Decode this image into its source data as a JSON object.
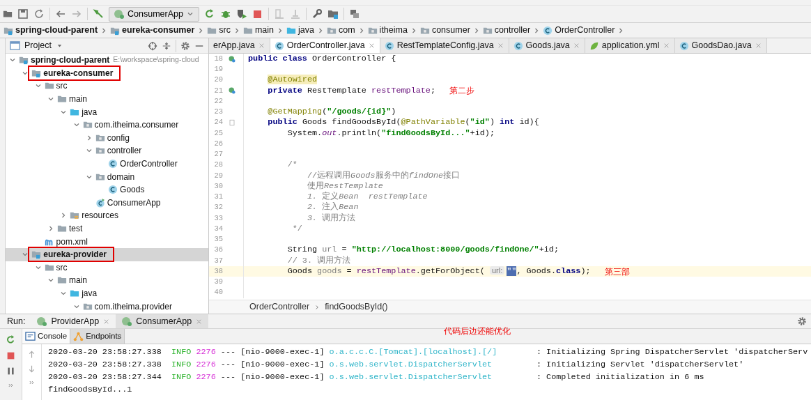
{
  "toolbar": {
    "run_config": "ConsumerApp"
  },
  "breadcrumbs": [
    {
      "label": "spring-cloud-parent",
      "kind": "module"
    },
    {
      "label": "eureka-consumer",
      "kind": "module"
    },
    {
      "label": "src",
      "kind": "folder"
    },
    {
      "label": "main",
      "kind": "folder"
    },
    {
      "label": "java",
      "kind": "source"
    },
    {
      "label": "com",
      "kind": "package"
    },
    {
      "label": "itheima",
      "kind": "package"
    },
    {
      "label": "consumer",
      "kind": "package"
    },
    {
      "label": "controller",
      "kind": "package"
    },
    {
      "label": "OrderController",
      "kind": "class"
    }
  ],
  "project_panel": {
    "title": "Project",
    "tree": [
      {
        "label": "spring-cloud-parent",
        "path": "E:\\workspace\\spring-cloud",
        "kind": "module",
        "expanded": true,
        "selected": false,
        "children": [
          {
            "label": "eureka-consumer",
            "kind": "module",
            "expanded": true,
            "boxed": true,
            "selected": false,
            "children": [
              {
                "label": "src",
                "kind": "folder",
                "expanded": true,
                "selected": false,
                "children": [
                  {
                    "label": "main",
                    "kind": "folder",
                    "expanded": true,
                    "selected": false,
                    "children": [
                      {
                        "label": "java",
                        "kind": "source",
                        "expanded": true,
                        "selected": false,
                        "children": [
                          {
                            "label": "com.itheima.consumer",
                            "kind": "package",
                            "expanded": true,
                            "selected": false,
                            "children": [
                              {
                                "label": "config",
                                "kind": "package",
                                "expanded": false,
                                "selected": false
                              },
                              {
                                "label": "controller",
                                "kind": "package",
                                "expanded": true,
                                "selected": false,
                                "children": [
                                  {
                                    "label": "OrderController",
                                    "kind": "class",
                                    "selected": false
                                  }
                                ]
                              },
                              {
                                "label": "domain",
                                "kind": "package",
                                "expanded": true,
                                "selected": false,
                                "children": [
                                  {
                                    "label": "Goods",
                                    "kind": "class",
                                    "selected": false
                                  }
                                ]
                              },
                              {
                                "label": "ConsumerApp",
                                "kind": "app",
                                "selected": false
                              }
                            ]
                          }
                        ]
                      },
                      {
                        "label": "resources",
                        "kind": "resources",
                        "expanded": false,
                        "selected": false
                      }
                    ]
                  },
                  {
                    "label": "test",
                    "kind": "folder",
                    "expanded": false,
                    "selected": false
                  }
                ]
              },
              {
                "label": "pom.xml",
                "kind": "pom",
                "selected": false
              }
            ]
          },
          {
            "label": "eureka-provider",
            "kind": "module",
            "expanded": true,
            "boxed": true,
            "selected": true,
            "children": [
              {
                "label": "src",
                "kind": "folder",
                "expanded": true,
                "selected": false,
                "children": [
                  {
                    "label": "main",
                    "kind": "folder",
                    "expanded": true,
                    "selected": false,
                    "children": [
                      {
                        "label": "java",
                        "kind": "source",
                        "expanded": true,
                        "selected": false,
                        "children": [
                          {
                            "label": "com.itheima.provider",
                            "kind": "package",
                            "expanded": true,
                            "selected": false
                          }
                        ]
                      }
                    ]
                  }
                ]
              }
            ]
          }
        ]
      }
    ]
  },
  "editor": {
    "tabs": [
      {
        "label": "erApp.java",
        "kind": "partial",
        "selected": false
      },
      {
        "label": "OrderController.java",
        "kind": "class",
        "selected": true
      },
      {
        "label": "RestTemplateConfig.java",
        "kind": "class",
        "selected": false
      },
      {
        "label": "Goods.java",
        "kind": "class",
        "selected": false
      },
      {
        "label": "application.yml",
        "kind": "yml",
        "selected": false
      },
      {
        "label": "GoodsDao.java",
        "kind": "class",
        "selected": false
      }
    ],
    "lines": [
      {
        "number": "18",
        "kind": "bean",
        "current": false,
        "tokens": [
          {
            "text": "public class",
            "kind": "keyword"
          },
          {
            "text": " OrderController {",
            "kind": "plain"
          }
        ],
        "children": [
          {
            "number": "19",
            "kind": "plain",
            "current": false
          },
          {
            "number": "20",
            "kind": "plain",
            "current": false,
            "tokens": [
              {
                "text": "@Autowired",
                "kind": "annotation_hl"
              }
            ]
          },
          {
            "number": "21",
            "kind": "bean",
            "current": false,
            "tokens": [
              {
                "text": "private",
                "kind": "keyword"
              },
              {
                "text": " RestTemplate ",
                "kind": "plain"
              },
              {
                "text": "restTemplate",
                "kind": "field"
              },
              {
                "text": ";",
                "kind": "plain"
              }
            ],
            "note": "第二步"
          },
          {
            "number": "22",
            "kind": "plain",
            "current": false
          },
          {
            "number": "23",
            "kind": "plain",
            "current": false,
            "tokens": [
              {
                "text": "@GetMapping",
                "kind": "annotation"
              },
              {
                "text": "(",
                "kind": "plain"
              },
              {
                "text": "\"/goods/{id}\"",
                "kind": "string"
              },
              {
                "text": ")",
                "kind": "plain"
              }
            ]
          },
          {
            "number": "24",
            "kind": "fold",
            "current": false,
            "tokens": [
              {
                "text": "public",
                "kind": "keyword"
              },
              {
                "text": " Goods findGoodsById(",
                "kind": "plain"
              },
              {
                "text": "@PathVariable",
                "kind": "annotation"
              },
              {
                "text": "(",
                "kind": "plain"
              },
              {
                "text": "\"id\"",
                "kind": "string"
              },
              {
                "text": ") ",
                "kind": "plain"
              },
              {
                "text": "int",
                "kind": "keyword"
              },
              {
                "text": " id){",
                "kind": "plain"
              }
            ],
            "children": [
              {
                "number": "25",
                "kind": "plain",
                "current": false,
                "tokens": [
                  {
                    "text": "System.",
                    "kind": "plain"
                  },
                  {
                    "text": "out",
                    "kind": "static"
                  },
                  {
                    "text": ".println(",
                    "kind": "plain"
                  },
                  {
                    "text": "\"findGoodsById...\"",
                    "kind": "string"
                  },
                  {
                    "text": "+id);",
                    "kind": "plain"
                  }
                ]
              },
              {
                "number": "26",
                "kind": "plain",
                "current": false
              },
              {
                "number": "27",
                "kind": "plain",
                "current": false
              },
              {
                "number": "28",
                "kind": "plain",
                "current": false,
                "tokens": [
                  {
                    "text": "/*",
                    "kind": "comment"
                  }
                ],
                "children": [
                  {
                    "number": "29",
                    "kind": "plain",
                    "current": false,
                    "tokens": [
                      {
                        "text": "//远程调用",
                        "kind": "comment"
                      },
                      {
                        "text": "Goods",
                        "kind": "comment_italic"
                      },
                      {
                        "text": "服务中的",
                        "kind": "comment"
                      },
                      {
                        "text": "findOne",
                        "kind": "comment_italic"
                      },
                      {
                        "text": "接口",
                        "kind": "comment"
                      }
                    ]
                  },
                  {
                    "number": "30",
                    "kind": "plain",
                    "current": false,
                    "tokens": [
                      {
                        "text": "使用",
                        "kind": "comment"
                      },
                      {
                        "text": "RestTemplate",
                        "kind": "comment_italic"
                      }
                    ]
                  },
                  {
                    "number": "31",
                    "kind": "plain",
                    "current": false,
                    "tokens": [
                      {
                        "text": "1. ",
                        "kind": "comment_italic"
                      },
                      {
                        "text": "定义",
                        "kind": "comment"
                      },
                      {
                        "text": "Bean  restTemplate",
                        "kind": "comment_italic"
                      }
                    ]
                  },
                  {
                    "number": "32",
                    "kind": "plain",
                    "current": false,
                    "tokens": [
                      {
                        "text": "2. ",
                        "kind": "comment_italic"
                      },
                      {
                        "text": "注入",
                        "kind": "comment"
                      },
                      {
                        "text": "Bean",
                        "kind": "comment_italic"
                      }
                    ]
                  },
                  {
                    "number": "33",
                    "kind": "plain",
                    "current": false,
                    "tokens": [
                      {
                        "text": "3. ",
                        "kind": "comment_italic"
                      },
                      {
                        "text": "调用方法",
                        "kind": "comment"
                      }
                    ]
                  }
                ]
              },
              {
                "number": "34",
                "kind": "plain",
                "current": false,
                "tokens": [
                  {
                    "text": " */",
                    "kind": "comment"
                  }
                ]
              },
              {
                "number": "35",
                "kind": "plain",
                "current": false
              },
              {
                "number": "36",
                "kind": "plain",
                "current": false,
                "tokens": [
                  {
                    "text": "String ",
                    "kind": "plain"
                  },
                  {
                    "text": "url",
                    "kind": "unused"
                  },
                  {
                    "text": " = ",
                    "kind": "plain"
                  },
                  {
                    "text": "\"http://localhost:8000/goods/findOne/\"",
                    "kind": "string"
                  },
                  {
                    "text": "+id;",
                    "kind": "plain"
                  }
                ]
              },
              {
                "number": "37",
                "kind": "plain",
                "current": false,
                "tokens": [
                  {
                    "text": "// 3. 调用方法",
                    "kind": "line_comment"
                  }
                ]
              },
              {
                "number": "38",
                "kind": "plain",
                "current": true,
                "tokens": [
                  {
                    "text": "Goods ",
                    "kind": "plain"
                  },
                  {
                    "text": "goods",
                    "kind": "unused"
                  },
                  {
                    "text": " = ",
                    "kind": "plain"
                  },
                  {
                    "text": "restTemplate",
                    "kind": "field"
                  },
                  {
                    "text": ".getForObject( ",
                    "kind": "plain"
                  },
                  {
                    "text": "url:",
                    "kind": "hint"
                  },
                  {
                    "text": "\"\"",
                    "kind": "selection"
                  },
                  {
                    "text": ", Goods.",
                    "kind": "plain"
                  },
                  {
                    "text": "class",
                    "kind": "keyword"
                  },
                  {
                    "text": ");",
                    "kind": "plain"
                  }
                ],
                "note": "第三部"
              }
            ]
          },
          {
            "number": "39",
            "kind": "plain",
            "current": false
          },
          {
            "number": "40",
            "kind": "plain",
            "current": false
          }
        ]
      }
    ],
    "breadcrumb": [
      "OrderController",
      "findGoodsById()"
    ]
  },
  "run_panel": {
    "label": "Run:",
    "tabs": [
      {
        "label": "ProviderApp",
        "selected": false
      },
      {
        "label": "ConsumerApp",
        "selected": true
      }
    ],
    "note": "代码后边还能优化",
    "subtabs": [
      {
        "label": "Console",
        "kind": "console",
        "selected": true
      },
      {
        "label": "Endpoints",
        "kind": "endpoints",
        "selected": false
      }
    ],
    "log": [
      {
        "kind": "entry",
        "time": "2020-03-20 23:58:27.338",
        "level": "INFO",
        "pid": "2276",
        "separator": "---",
        "thread": "[nio-9000-exec-1]",
        "logger": "o.a.c.c.C.[Tomcat].[localhost].[/]",
        "message": ": Initializing Spring DispatcherServlet 'dispatcherServ"
      },
      {
        "kind": "entry",
        "time": "2020-03-20 23:58:27.338",
        "level": "INFO",
        "pid": "2276",
        "separator": "---",
        "thread": "[nio-9000-exec-1]",
        "logger": "o.s.web.servlet.DispatcherServlet",
        "message": ": Initializing Servlet 'dispatcherServlet'"
      },
      {
        "kind": "entry",
        "time": "2020-03-20 23:58:27.344",
        "level": "INFO",
        "pid": "2276",
        "separator": "---",
        "thread": "[nio-9000-exec-1]",
        "logger": "o.s.web.servlet.DispatcherServlet",
        "message": ": Completed initialization in 6 ms"
      },
      {
        "kind": "output",
        "message": "findGoodsById...1"
      }
    ]
  }
}
